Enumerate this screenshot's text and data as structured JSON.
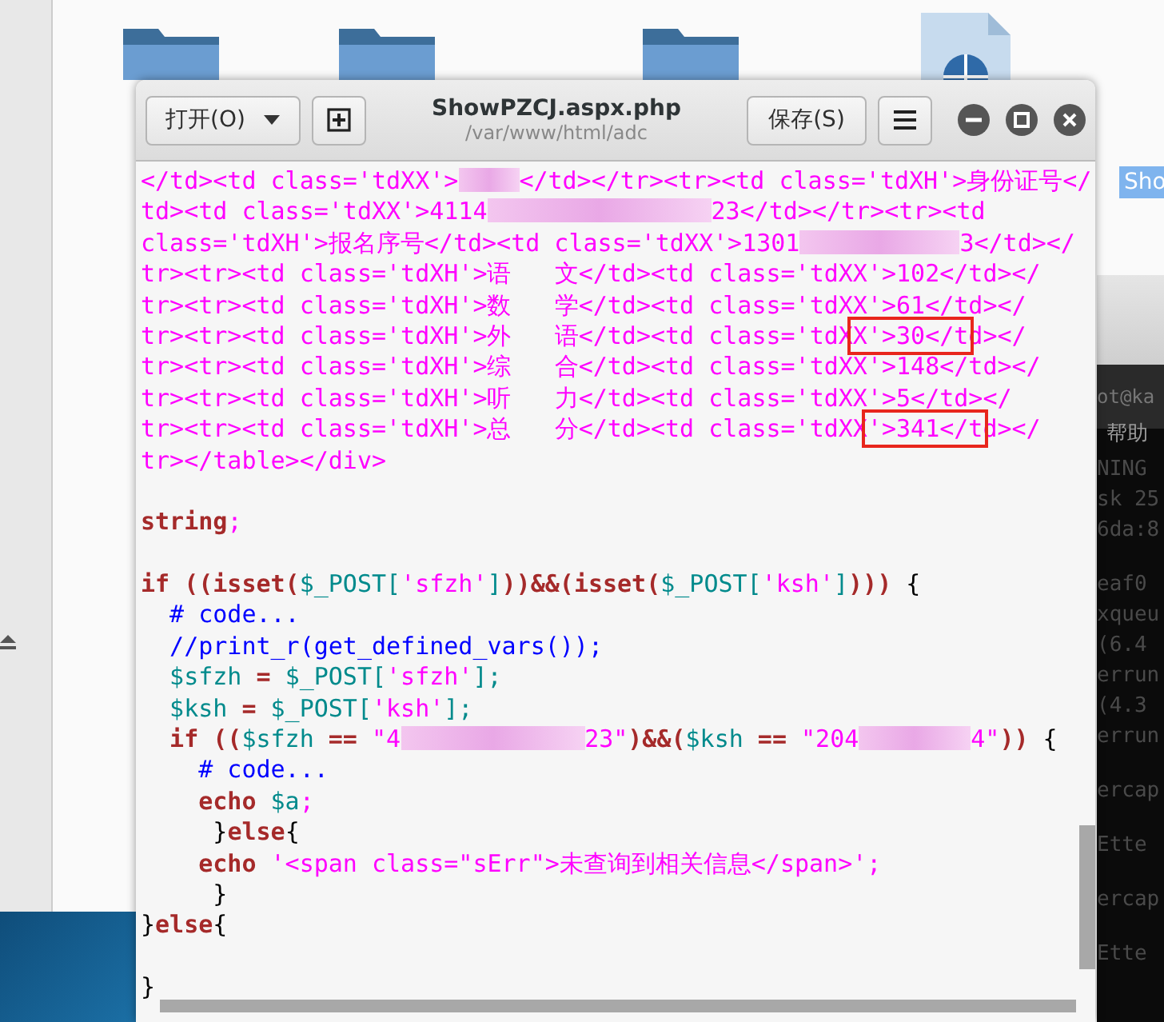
{
  "desktop": {
    "icons": [
      {
        "kind": "folder"
      },
      {
        "kind": "folder"
      },
      {
        "kind": "folder"
      },
      {
        "kind": "file"
      }
    ],
    "selected_label": "Sho"
  },
  "terminal": {
    "title": "ot@ka",
    "menu": "帮助",
    "groups": [
      [
        "NING",
        "sk 25",
        "6da:8"
      ],
      [
        "eaf0",
        "xqueu",
        "(6.4",
        "errun",
        "(4.3",
        "errun"
      ],
      [
        "ercap"
      ],
      [
        "Ette"
      ],
      [
        "ercap"
      ],
      [
        "Ette"
      ]
    ]
  },
  "editor": {
    "open_button": "打开(O)",
    "title": "ShowPZCJ.aspx.php",
    "path": "/var/www/html/adc",
    "save_button": "保存(S)",
    "blocks": [
      [
        [
          {
            "kind": "tag",
            "t": "</td><td class='tdXX'>"
          },
          {
            "kind": "redact-s"
          },
          {
            "kind": "tag",
            "t": "</td></tr><tr><td class='tdXH'>身份证号</"
          }
        ],
        [
          {
            "kind": "tag",
            "t": "td><td class='tdXX'>4114"
          },
          {
            "kind": "redact-xxl"
          },
          {
            "kind": "tag",
            "t": "23</td></tr><tr><td"
          }
        ],
        [
          {
            "kind": "tag",
            "t": "class='tdXH'>报名序号</td><td class='tdXX'>1301"
          },
          {
            "kind": "redact-l"
          },
          {
            "kind": "tag",
            "t": "3</td></"
          }
        ],
        [
          {
            "kind": "tag",
            "t": "tr><tr><td class='tdXH'>语   文</td><td class='tdXX'>102</td></"
          }
        ],
        [
          {
            "kind": "tag",
            "t": "tr><tr><td class='tdXH'>数   学</td><td class='tdXX'>61</td></"
          }
        ],
        [
          {
            "kind": "tag",
            "t": "tr><tr><td class='tdXH'>外   语</td><td class='tdX"
          },
          {
            "kind": "tag-framed",
            "t": "X'>30</t"
          },
          {
            "kind": "tag",
            "t": "d></"
          }
        ],
        [
          {
            "kind": "tag",
            "t": "tr><tr><td class='tdXH'>综   合</td><td class='tdXX'>148</td></"
          }
        ],
        [
          {
            "kind": "tag",
            "t": "tr><tr><td class='tdXH'>听   力</td><td class='tdXX'>5</td></"
          }
        ],
        [
          {
            "kind": "tag",
            "t": "tr><tr><td class='tdXH'>总   分</td><td class='tdXX"
          },
          {
            "kind": "tag-framed",
            "t": "'>341</t"
          },
          {
            "kind": "tag",
            "t": "d></"
          }
        ],
        [
          {
            "kind": "tag",
            "t": "tr></table></div>"
          }
        ]
      ],
      [
        [
          {
            "kind": "kw",
            "t": "string"
          },
          {
            "kind": "tag",
            "t": ";"
          }
        ]
      ],
      [
        [
          {
            "kind": "kw",
            "t": "if (("
          },
          {
            "kind": "kw",
            "t": "isset("
          },
          {
            "kind": "var",
            "t": "$_POST["
          },
          {
            "kind": "tag",
            "t": "'sfzh'"
          },
          {
            "kind": "var",
            "t": "]"
          },
          {
            "kind": "kw",
            "t": "))&&("
          },
          {
            "kind": "kw",
            "t": "isset("
          },
          {
            "kind": "var",
            "t": "$_POST["
          },
          {
            "kind": "tag",
            "t": "'ksh'"
          },
          {
            "kind": "var",
            "t": "]"
          },
          {
            "kind": "kw",
            "t": ")))"
          },
          {
            "kind": "plain",
            "t": " {"
          }
        ],
        [
          {
            "kind": "cmt",
            "t": "  # code..."
          }
        ],
        [
          {
            "kind": "cmt",
            "t": "  //print_r(get_defined_vars());"
          }
        ],
        [
          {
            "kind": "var",
            "t": "  $sfzh"
          },
          {
            "kind": "kw",
            "t": " = "
          },
          {
            "kind": "var",
            "t": "$_POST["
          },
          {
            "kind": "tag",
            "t": "'sfzh'"
          },
          {
            "kind": "var",
            "t": "];"
          }
        ],
        [
          {
            "kind": "var",
            "t": "  $ksh"
          },
          {
            "kind": "kw",
            "t": " = "
          },
          {
            "kind": "var",
            "t": "$_POST["
          },
          {
            "kind": "tag",
            "t": "'ksh'"
          },
          {
            "kind": "var",
            "t": "];"
          }
        ],
        [
          {
            "kind": "kw",
            "t": "  if (("
          },
          {
            "kind": "var",
            "t": "$sfzh"
          },
          {
            "kind": "kw",
            "t": " == "
          },
          {
            "kind": "tag",
            "t": "\"4"
          },
          {
            "kind": "redact-xl"
          },
          {
            "kind": "tag",
            "t": "23\""
          },
          {
            "kind": "kw",
            "t": ")&&("
          },
          {
            "kind": "var",
            "t": "$ksh"
          },
          {
            "kind": "kw",
            "t": " == "
          },
          {
            "kind": "tag",
            "t": "\"204"
          },
          {
            "kind": "redact-m"
          },
          {
            "kind": "tag",
            "t": "4\""
          },
          {
            "kind": "kw",
            "t": "))"
          },
          {
            "kind": "plain",
            "t": " {"
          }
        ],
        [
          {
            "kind": "cmt",
            "t": "    # code..."
          }
        ],
        [
          {
            "kind": "kw",
            "t": "    echo "
          },
          {
            "kind": "var",
            "t": "$a"
          },
          {
            "kind": "tag",
            "t": ";"
          }
        ],
        [
          {
            "kind": "plain",
            "t": "     }"
          },
          {
            "kind": "kw",
            "t": "else"
          },
          {
            "kind": "plain",
            "t": "{"
          }
        ],
        [
          {
            "kind": "kw",
            "t": "    echo "
          },
          {
            "kind": "tag",
            "t": "'<span class=\"sErr\">未查询到相关信息</span>';"
          }
        ],
        [
          {
            "kind": "plain",
            "t": "     }"
          }
        ],
        [
          {
            "kind": "plain",
            "t": "}"
          },
          {
            "kind": "kw",
            "t": "else"
          },
          {
            "kind": "plain",
            "t": "{"
          }
        ]
      ],
      [
        [
          {
            "kind": "plain",
            "t": "}"
          }
        ]
      ]
    ]
  }
}
